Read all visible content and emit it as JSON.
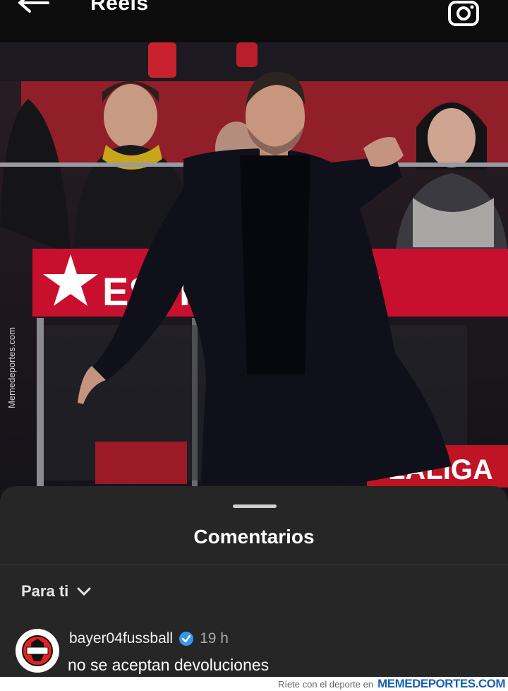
{
  "header": {
    "title": "Reels",
    "back_icon": "back-arrow-icon",
    "camera_icon": "camera-icon"
  },
  "video": {
    "side_watermark": "Memedeportes.com",
    "banner_left_text": "ESTRE",
    "banner_right_text": "M",
    "board_text": "LALIGA"
  },
  "comments_sheet": {
    "title": "Comentarios",
    "filter_label": "Para ti",
    "comment": {
      "username": "bayer04fussball",
      "time": "19 h",
      "text": "no se aceptan devoluciones"
    }
  },
  "footer": {
    "tagline": "Ríete con el deporte en",
    "site": "MEMEDEPORTES.COM"
  },
  "colors": {
    "accent_blue": "#3797f0",
    "banner_red": "#c8102e"
  }
}
